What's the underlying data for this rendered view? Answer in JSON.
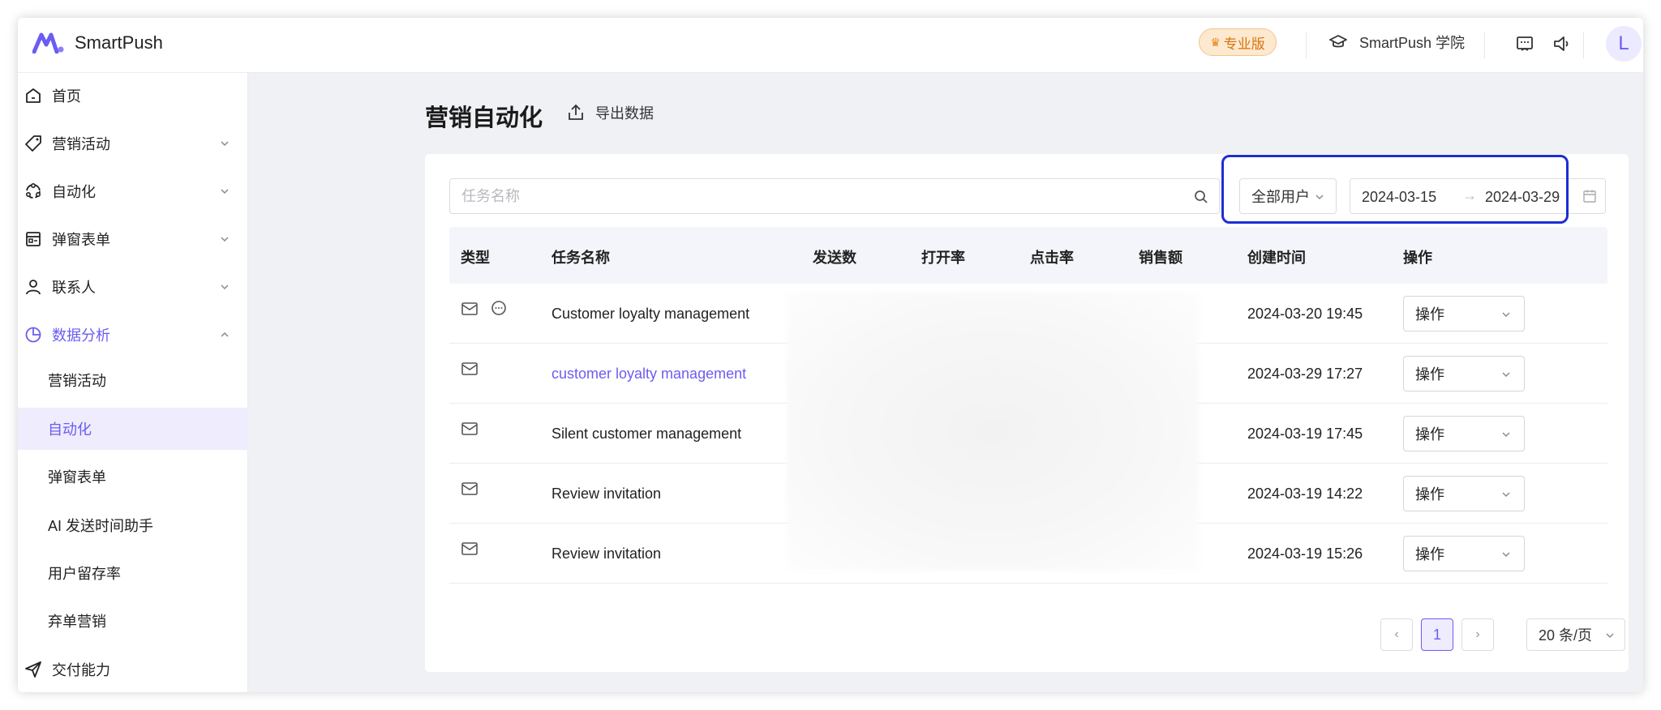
{
  "app": {
    "name": "SmartPush",
    "badge": "专业版",
    "academy": "SmartPush 学院",
    "avatar_letter": "L",
    "accent_color": "#6b5cf2",
    "highlight_color": "#1c2fd4"
  },
  "sidebar": {
    "items": [
      {
        "label": "首页",
        "icon": "home-icon"
      },
      {
        "label": "营销活动",
        "icon": "tag-icon"
      },
      {
        "label": "自动化",
        "icon": "automation-icon"
      },
      {
        "label": "弹窗表单",
        "icon": "form-icon"
      },
      {
        "label": "联系人",
        "icon": "user-icon"
      },
      {
        "label": "数据分析",
        "icon": "analytics-icon"
      },
      {
        "label": "交付能力",
        "icon": "send-icon"
      }
    ],
    "sub_items": [
      "营销活动",
      "自动化",
      "弹窗表单",
      "AI 发送时间助手",
      "用户留存率",
      "弃单营销"
    ],
    "selected_sub": "自动化"
  },
  "main": {
    "title": "营销自动化",
    "export_label": "导出数据"
  },
  "filters": {
    "search_placeholder": "任务名称",
    "user_select": "全部用户",
    "date_start": "2024-03-15",
    "date_arrow": "→",
    "date_end": "2024-03-29"
  },
  "table": {
    "columns": [
      "类型",
      "任务名称",
      "发送数",
      "打开率",
      "点击率",
      "销售额",
      "创建时间",
      "操作"
    ],
    "rows": [
      {
        "types": [
          "mail-icon",
          "chat-icon"
        ],
        "name": "Customer loyalty management",
        "created": "2024-03-20 19:45",
        "action": "操作"
      },
      {
        "types": [
          "mail-icon"
        ],
        "name": "customer loyalty management",
        "created": "2024-03-29 17:27",
        "action": "操作"
      },
      {
        "types": [
          "mail-icon"
        ],
        "name": "Silent customer management",
        "created": "2024-03-19 17:45",
        "action": "操作"
      },
      {
        "types": [
          "mail-icon"
        ],
        "name": "Review invitation",
        "created": "2024-03-19 14:22",
        "action": "操作"
      },
      {
        "types": [
          "mail-icon"
        ],
        "name": "Review invitation",
        "created": "2024-03-19 15:26",
        "action": "操作"
      }
    ]
  },
  "pagination": {
    "prev": "‹",
    "current": "1",
    "next": "›",
    "page_size": "20 条/页"
  }
}
